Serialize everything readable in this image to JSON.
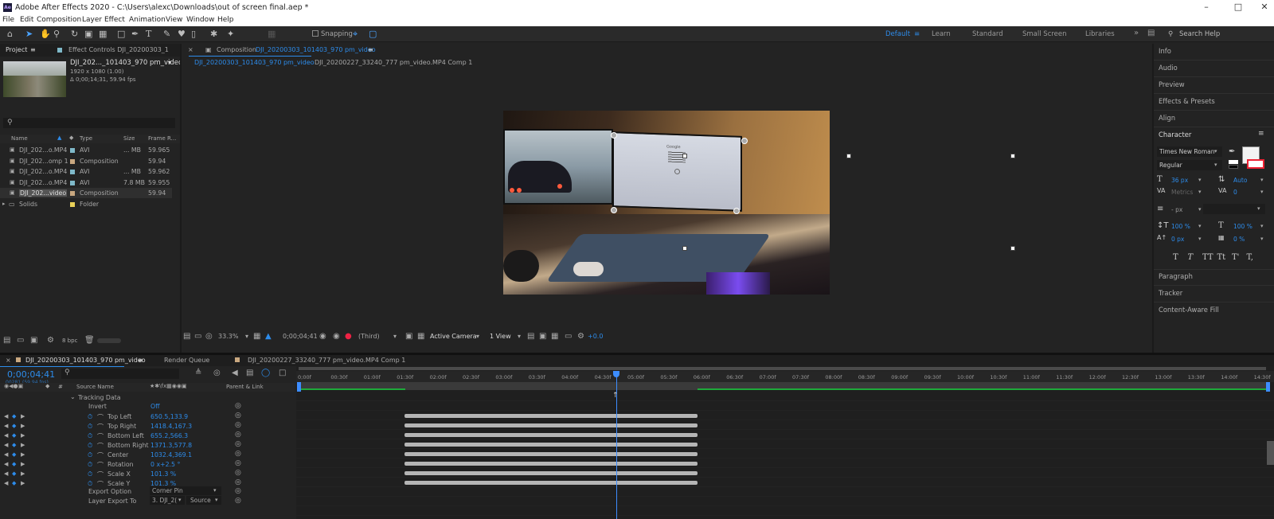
{
  "app": {
    "title": "Adobe After Effects 2020 - C:\\Users\\alexc\\Downloads\\out of screen final.aep *",
    "icon": "Ae"
  },
  "menu": [
    "File",
    "Edit",
    "Composition",
    "Layer",
    "Effect",
    "Animation",
    "View",
    "Window",
    "Help"
  ],
  "toolbar": {
    "snapping": "Snapping",
    "workspaces": [
      "Default",
      "Learn",
      "Standard",
      "Small Screen",
      "Libraries"
    ],
    "search_placeholder": "Search Help"
  },
  "project": {
    "tab": "Project",
    "effect_tab": "Effect Controls DJI_20200303_1",
    "selected_name": "DJI_202..._101403_970 pm_video",
    "selected_res": "1920 x 1080 (1.00)",
    "selected_dur": "Δ 0;00;14;31, 59.94 fps",
    "search_placeholder": "",
    "columns": [
      "Name",
      "Type",
      "Size",
      "Frame R..."
    ],
    "items": [
      {
        "name": "DJI_202...o.MP4",
        "type": "AVI",
        "size": "... MB",
        "fps": "59.965",
        "color": "#7fb9c9"
      },
      {
        "name": "DJI_202...omp 1",
        "type": "Composition",
        "size": "",
        "fps": "59.94",
        "color": "#c9a880"
      },
      {
        "name": "DJI_202...o.MP4",
        "type": "AVI",
        "size": "... MB",
        "fps": "59.962",
        "color": "#7fb9c9"
      },
      {
        "name": "DJI_202...o.MP4",
        "type": "AVI",
        "size": "7.8 MB",
        "fps": "59.955",
        "color": "#7fb9c9"
      },
      {
        "name": "DJI_202...video",
        "type": "Composition",
        "size": "",
        "fps": "59.94",
        "color": "#c9a880"
      },
      {
        "name": "Solids",
        "type": "Folder",
        "size": "",
        "fps": "",
        "color": "#e8d058"
      }
    ],
    "bpc": "8 bpc"
  },
  "comp": {
    "panel_label": "Composition",
    "panel_comp": "DJI_20200303_101403_970 pm_video",
    "tabs": [
      "DJI_20200303_101403_970 pm_video",
      "DJI_20200227_33240_777 pm_video.MP4 Comp 1"
    ],
    "zoom": "33.3%",
    "timecode": "0;00;04;41",
    "view_mode": "(Third)",
    "camera": "Active Camera",
    "views": "1 View",
    "exposure": "+0.0",
    "monitor_text": "Google"
  },
  "right_panels": [
    "Info",
    "Audio",
    "Preview",
    "Effects & Presets",
    "Align"
  ],
  "character": {
    "title": "Character",
    "font": "Times New Roman",
    "style": "Regular",
    "size": "36 px",
    "leading": "Auto",
    "kerning": "Metrics",
    "tracking": "0",
    "stroke": "- px",
    "vscale": "100 %",
    "hscale": "100 %",
    "baseline": "0 px",
    "tsume": "0 %",
    "styles": [
      "T",
      "T",
      "TT",
      "Tt",
      "T'",
      "T,"
    ]
  },
  "right_lower": [
    "Paragraph",
    "Tracker",
    "Content-Aware Fill"
  ],
  "timeline": {
    "tabs": [
      "DJI_20200303_101403_970 pm_video",
      "Render Queue",
      "DJI_20200227_33240_777 pm_video.MP4 Comp 1"
    ],
    "timecode": "0;00;04;41",
    "frame_info": "00281 (59.94 fps)",
    "col_source": "Source Name",
    "col_parent": "Parent & Link",
    "group": "Tracking Data",
    "invert_label": "Invert",
    "invert_value": "Off",
    "props": [
      {
        "name": "Top Left",
        "value": "650.5,133.9"
      },
      {
        "name": "Top Right",
        "value": "1418.4,167.3"
      },
      {
        "name": "Bottom Left",
        "value": "655.2,566.3"
      },
      {
        "name": "Bottom Right",
        "value": "1371.3,577.8"
      },
      {
        "name": "Center",
        "value": "1032.4,369.1"
      },
      {
        "name": "Rotation",
        "value": "0 x+2.5 °"
      },
      {
        "name": "Scale X",
        "value": "101.3 %"
      },
      {
        "name": "Scale Y",
        "value": "101.3 %"
      }
    ],
    "export_option_label": "Export Option",
    "export_option_value": "Corner Pin",
    "layer_export_label": "Layer Export To",
    "layer_export_value": "3. DJI_2(",
    "source_value": "Source",
    "ruler": [
      "0;00f",
      "00:30f",
      "01:00f",
      "01:30f",
      "02:00f",
      "02:30f",
      "03:00f",
      "03:30f",
      "04:00f",
      "04:30f",
      "05:00f",
      "05:30f",
      "06:00f",
      "06:30f",
      "07:00f",
      "07:30f",
      "08:00f",
      "08:30f",
      "09:00f",
      "09:30f",
      "10:00f",
      "10:30f",
      "11:00f",
      "11:30f",
      "12:00f",
      "12:30f",
      "13:00f",
      "13:30f",
      "14:00f",
      "14:30f"
    ],
    "playhead_seconds": 4.78
  }
}
